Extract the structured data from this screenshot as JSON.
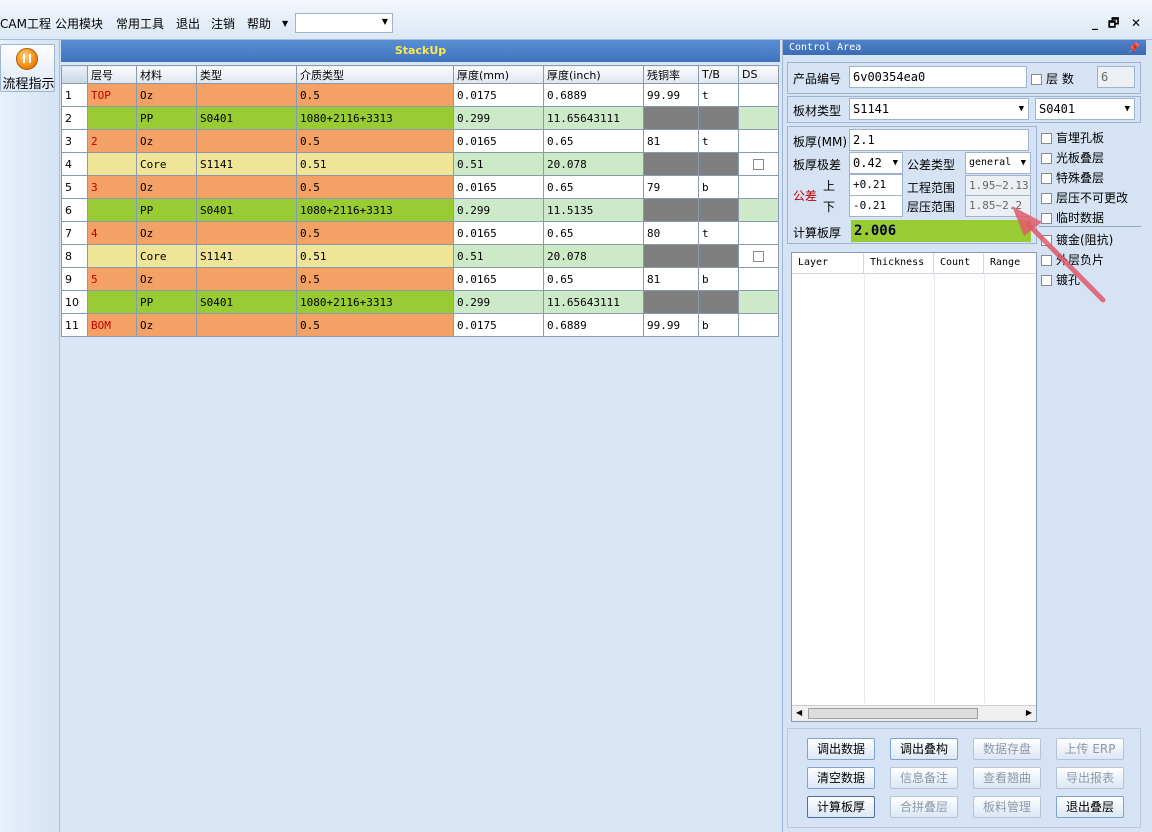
{
  "menu": {
    "items": [
      "CAM工程",
      "公用模块",
      "常用工具",
      "退出",
      "注销",
      "帮助"
    ],
    "combo_value": ""
  },
  "window_controls": {
    "minimize": "_",
    "restore": "🗗",
    "close": "✕"
  },
  "left": {
    "flow_label": "流程指示"
  },
  "stackup": {
    "title": "StackUp",
    "headers": [
      "",
      "层号",
      "材料",
      "类型",
      "介质类型",
      "厚度(mm)",
      "厚度(inch)",
      "残铜率",
      "T/B",
      "DS"
    ],
    "rows": [
      {
        "n": "1",
        "layer": "TOP",
        "mat": "Oz",
        "type": "",
        "diel": "0.5",
        "mm": "0.0175",
        "inch": "0.6889",
        "res": "99.99",
        "tb": "t",
        "ds": "",
        "kind": "cu"
      },
      {
        "n": "2",
        "layer": "",
        "mat": "PP",
        "type": "S0401",
        "diel": "1080+2116+3313",
        "mm": "0.299",
        "inch": "11.65643111",
        "res": "",
        "tb": "",
        "ds": "",
        "kind": "pp"
      },
      {
        "n": "3",
        "layer": "2",
        "mat": "Oz",
        "type": "",
        "diel": "0.5",
        "mm": "0.0165",
        "inch": "0.65",
        "res": "81",
        "tb": "t",
        "ds": "",
        "kind": "cu"
      },
      {
        "n": "4",
        "layer": "",
        "mat": "Core",
        "type": "S1141",
        "diel": "0.51",
        "mm": "0.51",
        "inch": "20.078",
        "res": "",
        "tb": "",
        "ds": "chk",
        "kind": "core"
      },
      {
        "n": "5",
        "layer": "3",
        "mat": "Oz",
        "type": "",
        "diel": "0.5",
        "mm": "0.0165",
        "inch": "0.65",
        "res": "79",
        "tb": "b",
        "ds": "",
        "kind": "cu"
      },
      {
        "n": "6",
        "layer": "",
        "mat": "PP",
        "type": "S0401",
        "diel": "1080+2116+3313",
        "mm": "0.299",
        "inch": "11.5135",
        "res": "",
        "tb": "",
        "ds": "",
        "kind": "pp"
      },
      {
        "n": "7",
        "layer": "4",
        "mat": "Oz",
        "type": "",
        "diel": "0.5",
        "mm": "0.0165",
        "inch": "0.65",
        "res": "80",
        "tb": "t",
        "ds": "",
        "kind": "cu"
      },
      {
        "n": "8",
        "layer": "",
        "mat": "Core",
        "type": "S1141",
        "diel": "0.51",
        "mm": "0.51",
        "inch": "20.078",
        "res": "",
        "tb": "",
        "ds": "chk",
        "kind": "core"
      },
      {
        "n": "9",
        "layer": "5",
        "mat": "Oz",
        "type": "",
        "diel": "0.5",
        "mm": "0.0165",
        "inch": "0.65",
        "res": "81",
        "tb": "b",
        "ds": "",
        "kind": "cu"
      },
      {
        "n": "10",
        "layer": "",
        "mat": "PP",
        "type": "S0401",
        "diel": "1080+2116+3313",
        "mm": "0.299",
        "inch": "11.65643111",
        "res": "",
        "tb": "",
        "ds": "",
        "kind": "pp"
      },
      {
        "n": "11",
        "layer": "BOM",
        "mat": "Oz",
        "type": "",
        "diel": "0.5",
        "mm": "0.0175",
        "inch": "0.6889",
        "res": "99.99",
        "tb": "b",
        "ds": "",
        "kind": "cu"
      }
    ]
  },
  "control": {
    "title": "Control Area",
    "product_label": "产品编号",
    "product_value": "6v00354ea0",
    "layers_label": "层 数",
    "layers_value": "6",
    "board_type_label": "板材类型",
    "board_type_value": "S1141",
    "pp_type_value": "S0401",
    "thickness_label": "板厚(MM)",
    "thickness_value": "2.1",
    "tol_label": "板厚极差",
    "tol_value": "0.42",
    "tol_type_label": "公差类型",
    "tol_type_value": "general",
    "tolerance_label": "公差",
    "upper_label": "上",
    "lower_label": "下",
    "upper_value": "+0.21",
    "lower_value": "-0.21",
    "eng_range_label": "工程范围",
    "eng_range_value": "1.95~2.13",
    "press_range_label": "层压范围",
    "press_range_value": "1.85~2.2",
    "calc_label": "计算板厚",
    "calc_value": "2.006",
    "options1": [
      "盲埋孔板",
      "光板叠层",
      "特殊叠层",
      "层压不可更改",
      "临时数据"
    ],
    "options2": [
      "镀金(阻抗)",
      "外层负片",
      "镀孔"
    ],
    "list_headers": [
      "Layer",
      "Thickness",
      "Count",
      "Range"
    ],
    "buttons": [
      [
        "调出数据",
        "调出叠构",
        "数据存盘",
        "上传 ERP"
      ],
      [
        "清空数据",
        "信息备注",
        "查看翘曲",
        "导出报表"
      ],
      [
        "计算板厚",
        "合拼叠层",
        "板料管理",
        "退出叠层"
      ]
    ],
    "buttons_enabled": [
      [
        true,
        true,
        false,
        false
      ],
      [
        true,
        false,
        false,
        false
      ],
      [
        true,
        false,
        false,
        true
      ]
    ]
  }
}
